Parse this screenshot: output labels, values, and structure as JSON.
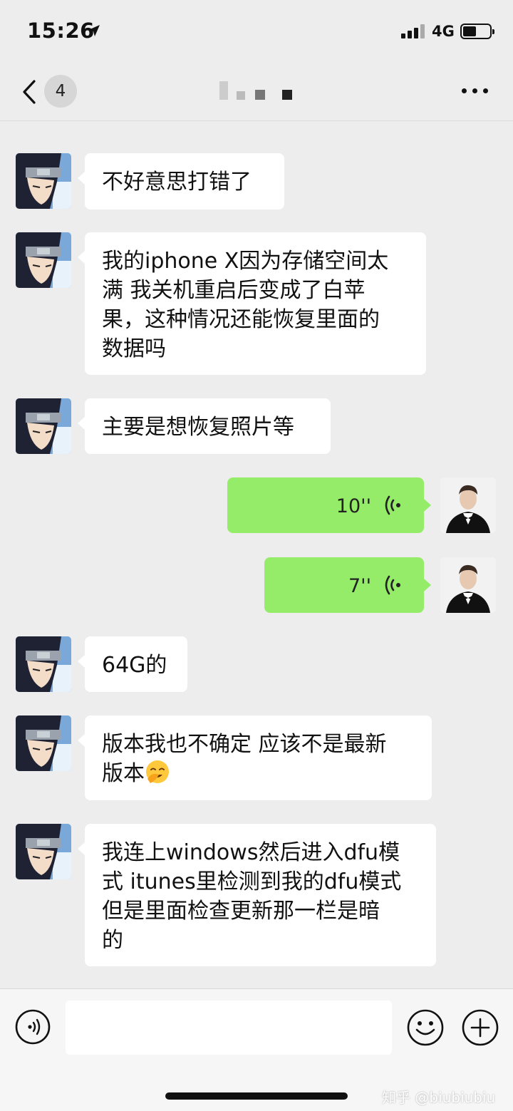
{
  "status_bar": {
    "time": "15:26",
    "network": "4G",
    "battery_level": 0.4
  },
  "nav": {
    "unread_count": "4",
    "icons": [
      "chevron-left-icon",
      "more-icon"
    ]
  },
  "messages": [
    {
      "side": "in",
      "text": "不好意思打错了"
    },
    {
      "side": "in",
      "lines": [
        "我的iphone X因为存储空间太",
        "满 我关机重启后变成了白苹",
        "果，这种情况还能恢复里面的",
        "数据吗"
      ]
    },
    {
      "side": "in",
      "text": "主要是想恢复照片等"
    },
    {
      "side": "out",
      "type": "voice",
      "duration": "10''"
    },
    {
      "side": "out",
      "type": "voice",
      "duration": "7''"
    },
    {
      "side": "in",
      "text": "64G的"
    },
    {
      "side": "in",
      "lines": [
        "版本我也不确定 应该不是最新",
        "版本"
      ],
      "emoji": "facepalm-emoji"
    },
    {
      "side": "in",
      "lines": [
        "我连上windows然后进入dfu模",
        "式 itunes里检测到我的dfu模式",
        "但是里面检查更新那一栏是暗",
        "的"
      ]
    }
  ],
  "input_bar": {
    "placeholder": "",
    "watermark": "知乎 @biubiubiu"
  },
  "colors": {
    "background": "#ededed",
    "outgoing_bubble": "#95ec69",
    "incoming_bubble": "#ffffff"
  }
}
